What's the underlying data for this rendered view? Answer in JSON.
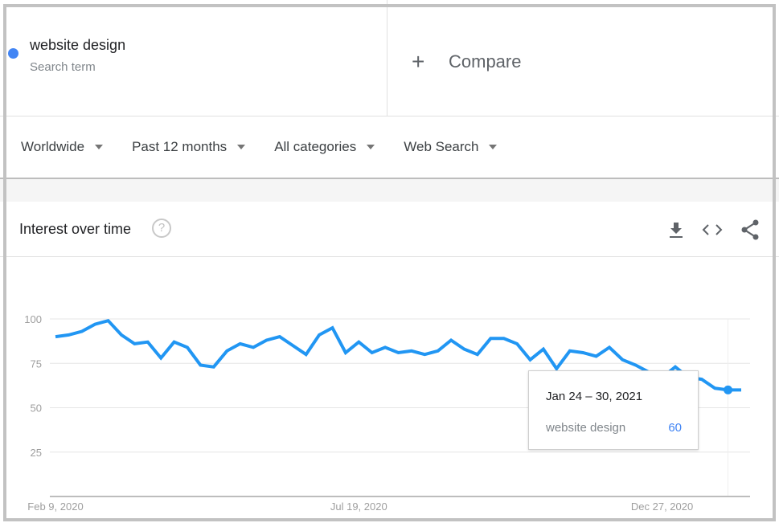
{
  "search_term": {
    "name": "website design",
    "subtitle": "Search term",
    "color": "#4285f4"
  },
  "compare": {
    "icon": "plus-icon",
    "label": "Compare"
  },
  "filters": [
    {
      "label": "Worldwide",
      "icon": "caret-down-icon"
    },
    {
      "label": "Past 12 months",
      "icon": "caret-down-icon"
    },
    {
      "label": "All categories",
      "icon": "caret-down-icon"
    },
    {
      "label": "Web Search",
      "icon": "caret-down-icon"
    }
  ],
  "card": {
    "title": "Interest over time",
    "help_icon": "?",
    "actions": [
      "download-icon",
      "embed-code-icon",
      "share-icon"
    ]
  },
  "tooltip": {
    "date": "Jan 24 – 30, 2021",
    "term": "website design",
    "value": "60"
  },
  "chart_data": {
    "type": "line",
    "title": "Interest over time",
    "xlabel": "",
    "ylabel": "",
    "ylim": [
      0,
      100
    ],
    "yticks": [
      "100",
      "75",
      "50",
      "25"
    ],
    "ytick_values": [
      100,
      75,
      50,
      25
    ],
    "xtick_labels": [
      "Feb 9, 2020",
      "Jul 19, 2020",
      "Dec 27, 2020"
    ],
    "xtick_indices": [
      0,
      23,
      46
    ],
    "grid": true,
    "legend": "none",
    "highlighted_index": 51,
    "series": [
      {
        "name": "website design",
        "color": "#2196f3",
        "values": [
          90,
          91,
          93,
          97,
          99,
          91,
          86,
          87,
          78,
          87,
          84,
          74,
          73,
          82,
          86,
          84,
          88,
          90,
          85,
          80,
          91,
          95,
          81,
          87,
          81,
          84,
          81,
          82,
          80,
          82,
          88,
          83,
          80,
          89,
          89,
          86,
          77,
          83,
          72,
          82,
          81,
          79,
          84,
          77,
          74,
          70,
          67,
          73,
          67,
          66,
          61,
          60,
          60
        ]
      }
    ]
  }
}
